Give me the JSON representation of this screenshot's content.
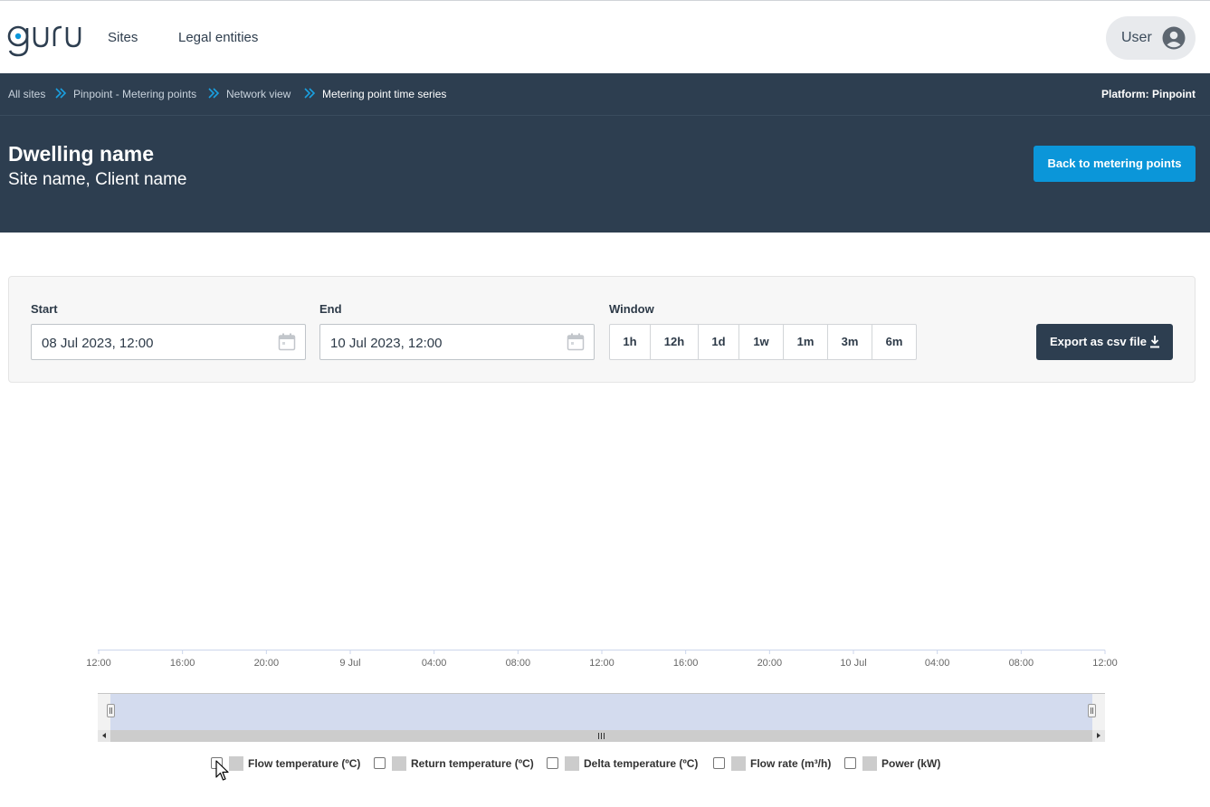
{
  "nav": {
    "logo_text": "guru",
    "links": [
      "Sites",
      "Legal entities"
    ],
    "user_label": "User"
  },
  "breadcrumb": {
    "items": [
      "All sites",
      "Pinpoint - Metering points",
      "Network view",
      "Metering point time series"
    ],
    "platform": "Platform: Pinpoint"
  },
  "header": {
    "title": "Dwelling name",
    "subtitle": "Site name, Client name",
    "back_button": "Back to metering points"
  },
  "filters": {
    "start_label": "Start",
    "start_value": "08 Jul 2023, 12:00",
    "end_label": "End",
    "end_value": "10 Jul 2023, 12:00",
    "window_label": "Window",
    "window_options": [
      "1h",
      "12h",
      "1d",
      "1w",
      "1m",
      "3m",
      "6m"
    ],
    "export_label": "Export as csv file"
  },
  "chart": {
    "x_ticks": [
      "12:00",
      "16:00",
      "20:00",
      "9 Jul",
      "04:00",
      "08:00",
      "12:00",
      "16:00",
      "20:00",
      "10 Jul",
      "04:00",
      "08:00",
      "12:00"
    ]
  },
  "legend": {
    "items": [
      {
        "label": "Flow temperature (ºC)",
        "checked": false
      },
      {
        "label": "Return temperature (ºC)",
        "checked": false
      },
      {
        "label": "Delta temperature (ºC)",
        "checked": false
      },
      {
        "label": "Flow rate (m³/h)",
        "checked": false
      },
      {
        "label": "Power (kW)",
        "checked": false
      }
    ]
  },
  "colors": {
    "header_bg": "#2d3e50",
    "accent_blue": "#0b96d9",
    "navigator_mask": "#d3dbee"
  },
  "icons": [
    "guru-logo",
    "user-icon",
    "double-chevron-right-icon",
    "calendar-icon",
    "download-icon",
    "mouse-cursor-icon"
  ]
}
